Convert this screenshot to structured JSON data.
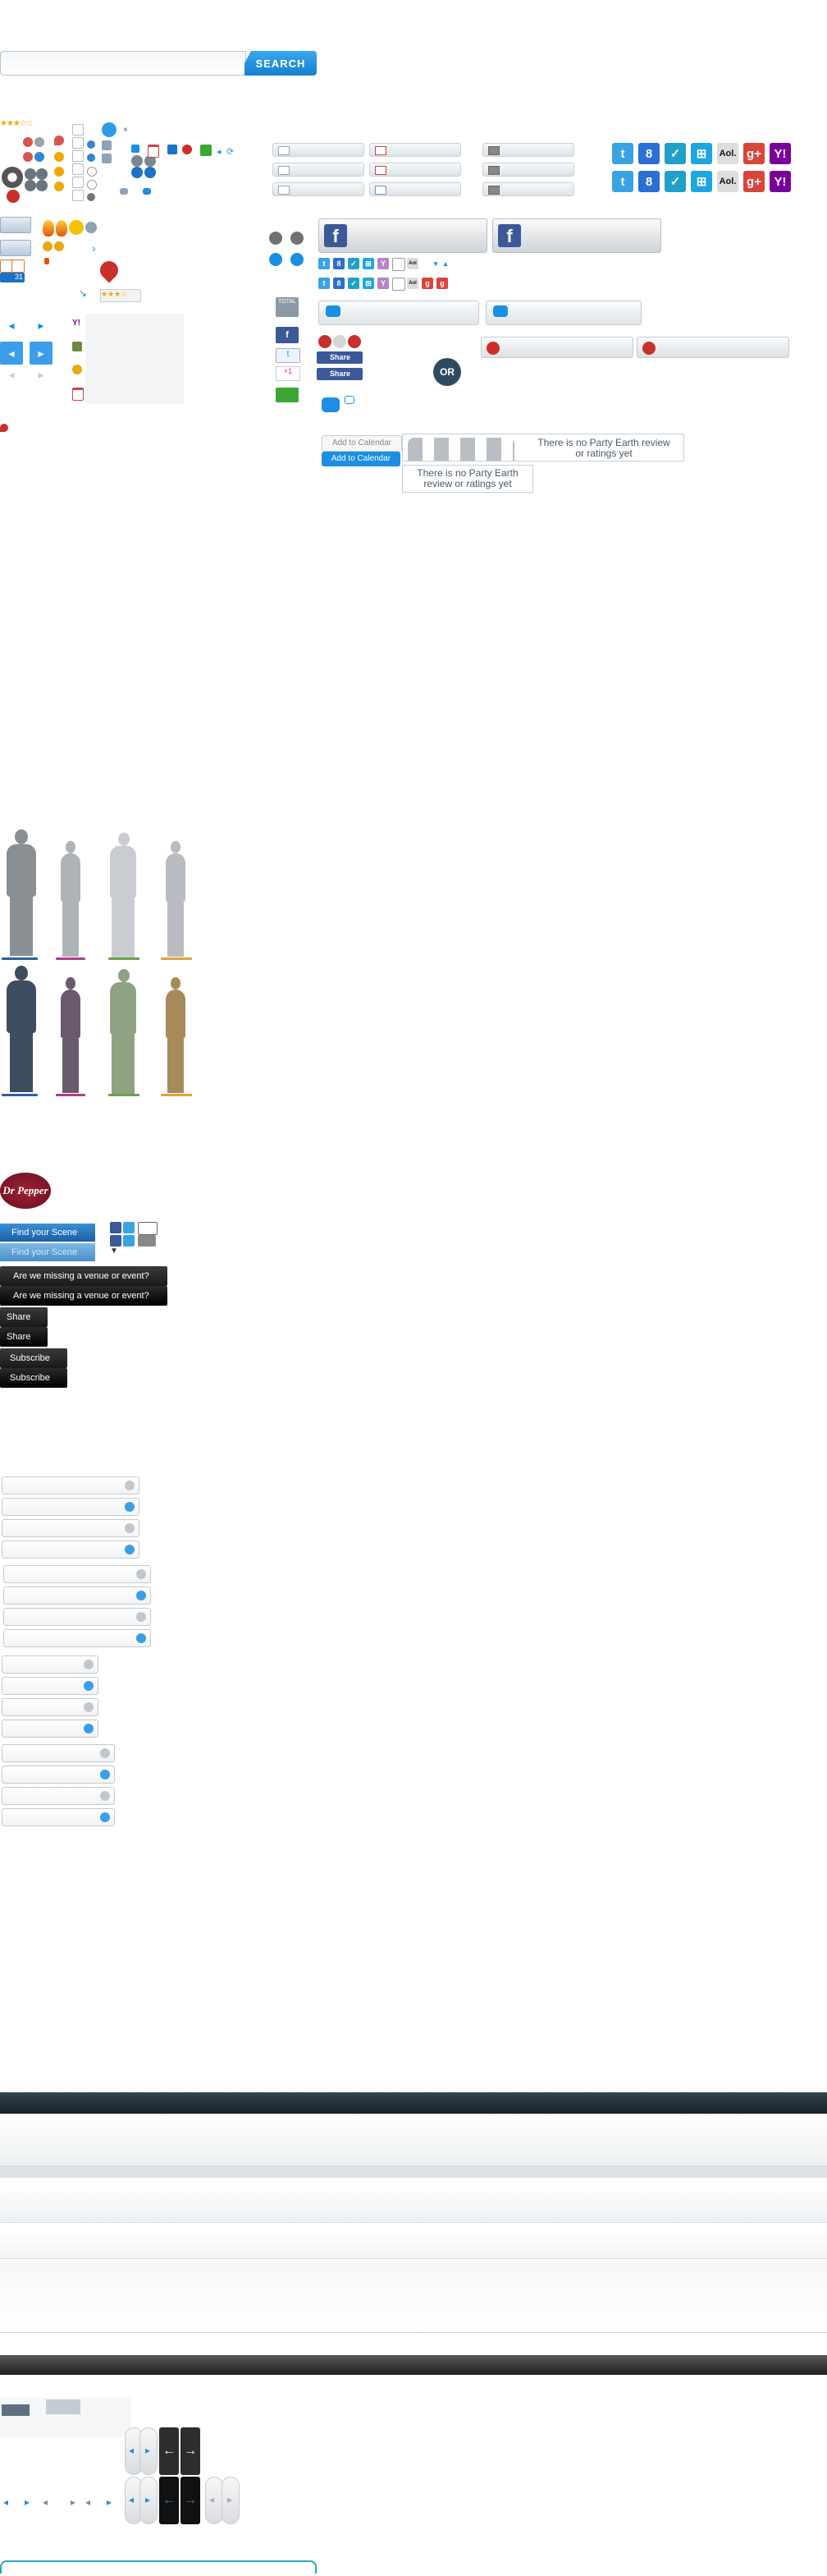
{
  "search": {
    "placeholder": "",
    "button_label": "SEARCH"
  },
  "misc_sprites": {
    "stars_label": "★★★☆☆",
    "rating_widget_stars": "★★★☆",
    "calendar_date": "31"
  },
  "share_bars": {
    "rows": [
      "mail",
      "calendar",
      "print"
    ]
  },
  "social_icons": {
    "row1": [
      "twitter",
      "google",
      "check",
      "windows",
      "aol",
      "google-plus",
      "yahoo"
    ],
    "row2": [
      "twitter",
      "google",
      "check",
      "windows",
      "aol",
      "google-plus",
      "yahoo"
    ],
    "aol_text": "Aol.",
    "gplus_text": "g+",
    "yahoo_text": "Y!",
    "google_text": "8"
  },
  "left_rail": {
    "total_label": "TOTAL",
    "gplus_label": "+1"
  },
  "facebook": {
    "f_letter": "f"
  },
  "fb_share": {
    "label_1": "Share",
    "label_2": "Share"
  },
  "or_badge": "OR",
  "calendar": {
    "add_label_gray": "Add to Calendar",
    "add_label_blue": "Add to Calendar"
  },
  "reviews": {
    "no_rating_text_1": "There is no Party Earth review or ratings yet",
    "no_rating_text_2": "There is no Party Earth review or ratings yet"
  },
  "brand": {
    "logo_text": "Dr Pepper"
  },
  "scene": {
    "find_label": "Find your Scene",
    "find_label_2": "Find your Scene",
    "missing_1": "Are we missing a venue or event?",
    "missing_2": "Are we missing a venue or event?",
    "share_1": "Share",
    "share_2": "Share",
    "subscribe_1": "Subscribe",
    "subscribe_2": "Subscribe"
  },
  "colors": {
    "accent_blue": "#1a8fe3",
    "facebook": "#3b5998",
    "twitter": "#3aa3e3",
    "red": "#c9302c",
    "green": "#3aa635",
    "dark_band": "#1f2a33"
  }
}
